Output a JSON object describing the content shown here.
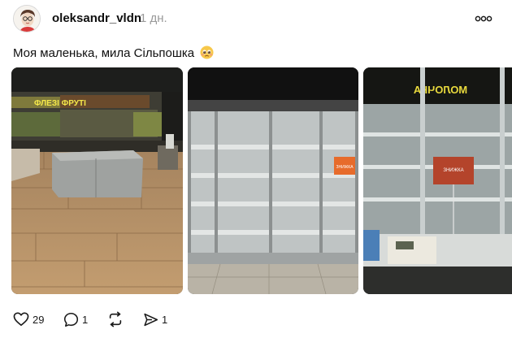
{
  "post": {
    "author": "oleksandr_vldn",
    "time": "1 дн.",
    "text": "Моя маленька, мила Сільпошка",
    "emoji": "pleading-face-emoji",
    "photos": [
      {
        "name": "photo-store-empty-hall",
        "neon_sign": "ФЛЕЗІ ФРУТІ"
      },
      {
        "name": "photo-empty-fridges",
        "sign": "ЗНИЖКА"
      },
      {
        "name": "photo-empty-dairy-shelves",
        "neon_sign": "МОЛОЧКА",
        "sign": "ЗНИЖКА"
      }
    ],
    "actions": {
      "likes": "29",
      "replies": "1",
      "reposts": "",
      "shares": "1"
    }
  },
  "icons": {
    "like": "heart-icon",
    "reply": "comment-icon",
    "repost": "repost-icon",
    "share": "send-icon",
    "more": "more-icon"
  }
}
